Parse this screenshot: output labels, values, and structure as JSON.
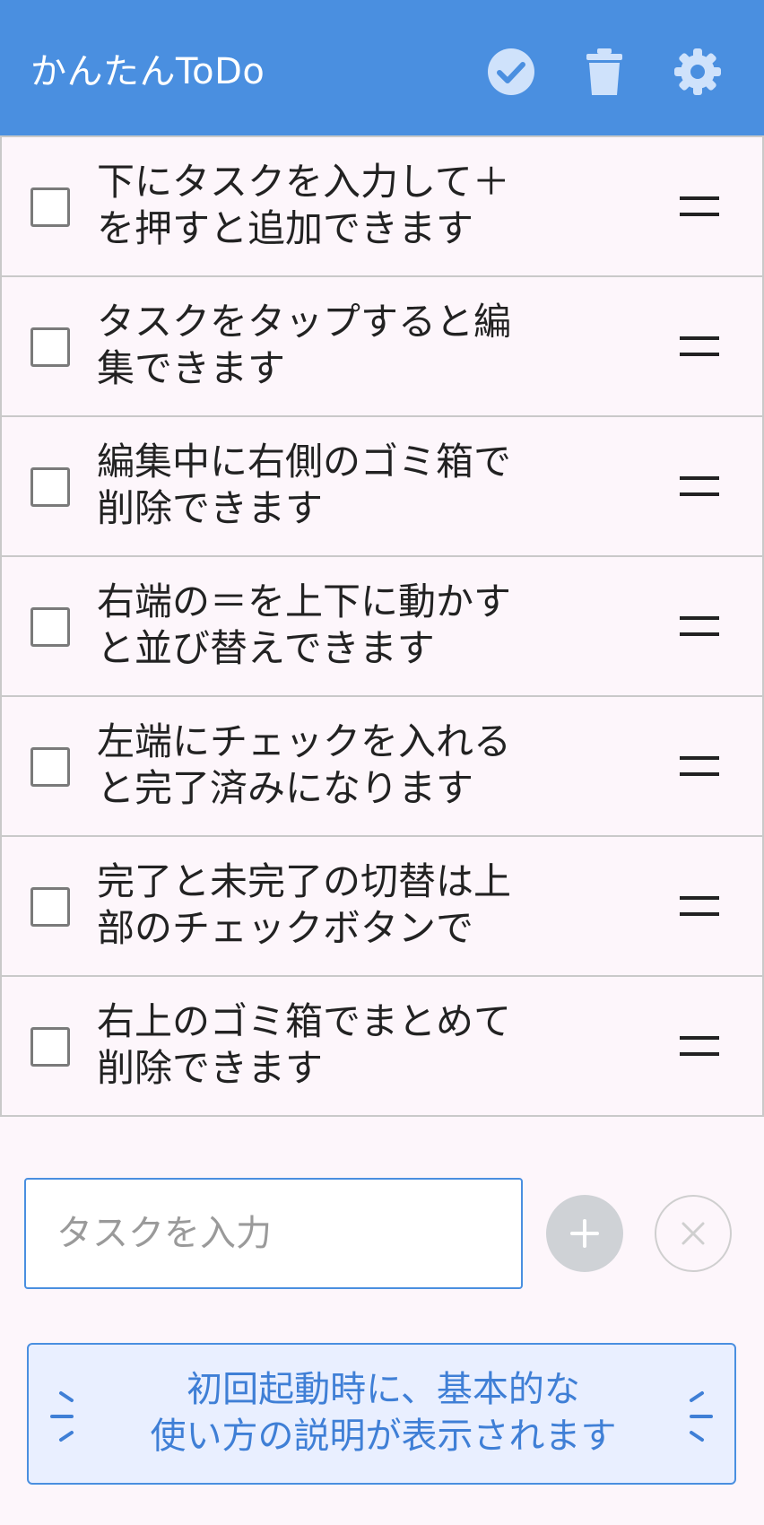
{
  "app": {
    "title": "かんたんToDo"
  },
  "colors": {
    "accent": "#4a8fe0",
    "background": "#fdf6fb",
    "banner_bg": "#e9efff",
    "banner_text": "#3f7fd6"
  },
  "toolbar": {
    "icons": [
      "check-circle-icon",
      "trash-icon",
      "gear-icon"
    ]
  },
  "tasks": [
    {
      "text": "下にタスクを入力して＋を押すと追加できます",
      "done": false
    },
    {
      "text": "タスクをタップすると編集できます",
      "done": false
    },
    {
      "text": "編集中に右側のゴミ箱で削除できます",
      "done": false
    },
    {
      "text": "右端の＝を上下に動かすと並び替えできます",
      "done": false
    },
    {
      "text": "左端にチェックを入れると完了済みになります",
      "done": false
    },
    {
      "text": "完了と未完了の切替は上部のチェックボタンで",
      "done": false
    },
    {
      "text": "右上のゴミ箱でまとめて削除できます",
      "done": false
    }
  ],
  "input": {
    "placeholder": "タスクを入力",
    "value": ""
  },
  "banner": {
    "line1": "初回起動時に、基本的な",
    "line2": "使い方の説明が表示されます"
  }
}
